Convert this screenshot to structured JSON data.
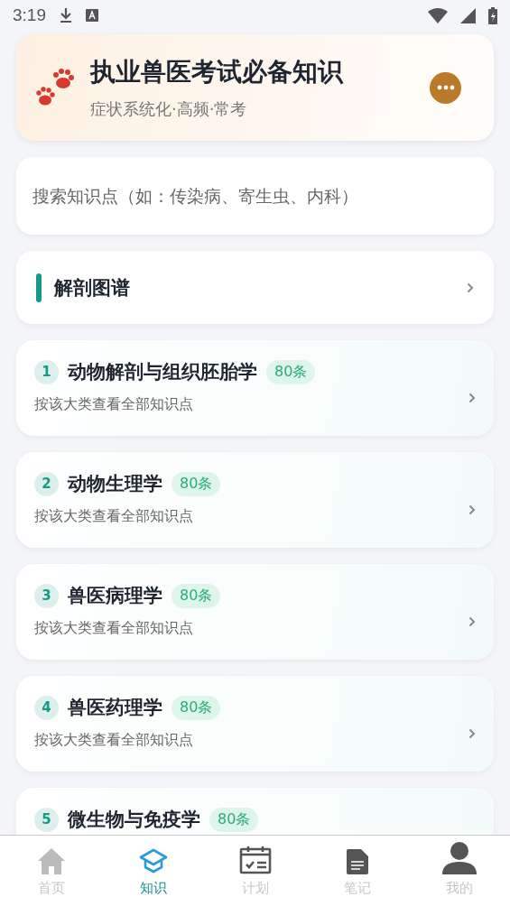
{
  "status_bar": {
    "time": "3:19"
  },
  "header": {
    "title": "执业兽医考试必备知识",
    "subtitle": "症状系统化·高频·常考"
  },
  "search": {
    "placeholder": "搜索知识点（如：传染病、寄生虫、内科）"
  },
  "anatomy": {
    "label": "解剖图谱"
  },
  "categories": [
    {
      "index": "1",
      "title": "动物解剖与组织胚胎学",
      "count": "80条",
      "subtitle": "按该大类查看全部知识点"
    },
    {
      "index": "2",
      "title": "动物生理学",
      "count": "80条",
      "subtitle": "按该大类查看全部知识点"
    },
    {
      "index": "3",
      "title": "兽医病理学",
      "count": "80条",
      "subtitle": "按该大类查看全部知识点"
    },
    {
      "index": "4",
      "title": "兽医药理学",
      "count": "80条",
      "subtitle": "按该大类查看全部知识点"
    },
    {
      "index": "5",
      "title": "微生物与免疫学",
      "count": "80条"
    }
  ],
  "tabs": [
    {
      "kind": "home",
      "label": "首页",
      "selected": false
    },
    {
      "kind": "knowledge",
      "label": "知识",
      "selected": true
    },
    {
      "kind": "plan",
      "label": "计划",
      "selected": false
    },
    {
      "kind": "notes",
      "label": "笔记",
      "selected": false
    },
    {
      "kind": "mine",
      "label": "我的",
      "selected": false
    }
  ]
}
